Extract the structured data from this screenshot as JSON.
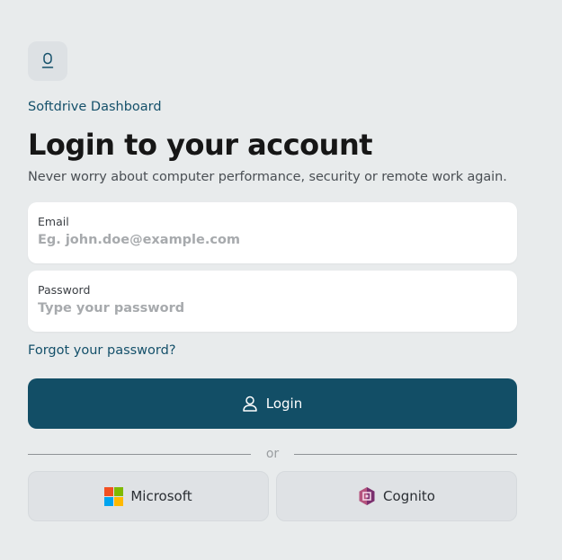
{
  "app": {
    "name": "Softdrive Dashboard"
  },
  "header": {
    "title": "Login to your account",
    "tagline": "Never worry about computer performance, security or remote work again."
  },
  "form": {
    "email": {
      "label": "Email",
      "placeholder": "Eg. john.doe@example.com",
      "value": ""
    },
    "password": {
      "label": "Password",
      "placeholder": "Type your password",
      "value": ""
    },
    "forgot_label": "Forgot your password?",
    "login_label": "Login"
  },
  "divider": {
    "label": "or"
  },
  "sso": [
    {
      "label": "Microsoft",
      "icon": "microsoft-logo-icon"
    },
    {
      "label": "Cognito",
      "icon": "cognito-logo-icon"
    }
  ],
  "colors": {
    "background": "#e8ebec",
    "primary": "#124e66",
    "link": "#14506a",
    "ms_red": "#f25022",
    "ms_green": "#7fba00",
    "ms_blue": "#00a4ef",
    "ms_yellow": "#ffb900",
    "cognito": "#8c3a8c"
  }
}
